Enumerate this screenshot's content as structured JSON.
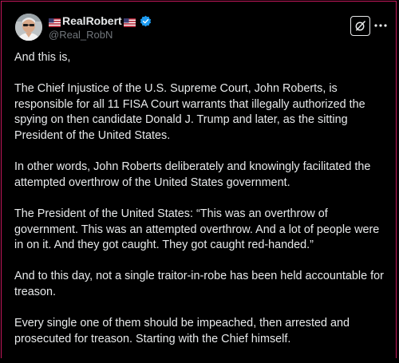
{
  "author": {
    "display_name": "RealRobert",
    "handle": "@Real_RobN",
    "verified_icon": "verified-badge-icon",
    "flag_icon": "us-flag-icon"
  },
  "actions": {
    "grok_icon": "grok-icon",
    "more_icon": "more-horizontal-icon"
  },
  "post": {
    "paragraphs": [
      "And this is,",
      "The Chief Injustice of the U.S. Supreme Court, John Roberts, is responsible for all 11 FISA Court warrants that illegally authorized the spying on then candidate Donald J. Trump and later, as the sitting President of the United States.",
      "In other words, John Roberts deliberately and knowingly facilitated the attempted overthrow of the United States government.",
      "The President of the United States: “This was an overthrow of government. This was an attempted overthrow. And a lot of people were in on it. And they got caught. They got caught red-handed.”",
      "And to this day, not a single traitor-in-robe has been held accountable for treason.",
      "Every single one of them should be impeached, then arrested and prosecuted for treason. Starting with the Chief himself."
    ]
  },
  "colors": {
    "background": "#000000",
    "text": "#e7e9ea",
    "secondary_text": "#71767b",
    "verified_blue": "#1d9bf0",
    "frame_border": "#c2185b"
  }
}
